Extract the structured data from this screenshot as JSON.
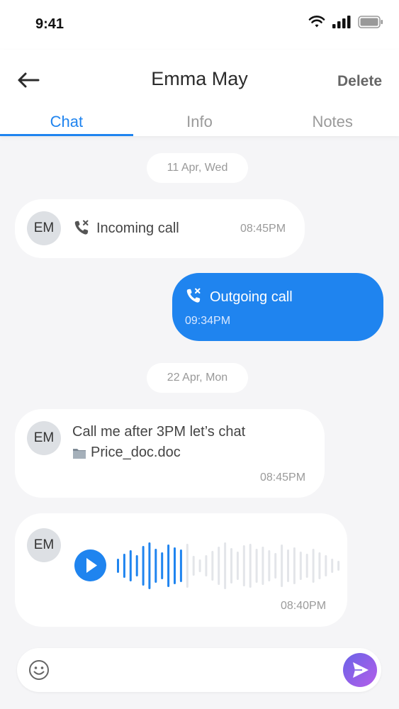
{
  "status": {
    "time": "9:41"
  },
  "header": {
    "title": "Emma May",
    "delete_label": "Delete"
  },
  "tabs": [
    {
      "label": "Chat",
      "active": true
    },
    {
      "label": "Info",
      "active": false
    },
    {
      "label": "Notes",
      "active": false
    }
  ],
  "messages": {
    "date1": "11 Apr, Wed",
    "incoming_call": {
      "avatar": "EM",
      "label": "Incoming call",
      "time": "08:45PM"
    },
    "outgoing_call": {
      "label": "Outgoing call",
      "time": "09:34PM"
    },
    "date2": "22 Apr, Mon",
    "text_msg": {
      "avatar": "EM",
      "text": "Call me after 3PM let’s chat",
      "attachment": "Price_doc.doc",
      "time": "08:45PM"
    },
    "voice_msg": {
      "avatar": "EM",
      "time": "08:40PM",
      "played_fraction": 0.3
    }
  },
  "composer": {
    "placeholder": ""
  },
  "colors": {
    "accent": "#1f84ef",
    "send_start": "#6a63e8",
    "send_end": "#b45ee9"
  },
  "icons": [
    "wifi-icon",
    "signal-icon",
    "battery-icon",
    "back-arrow-icon",
    "missed-call-icon",
    "file-icon",
    "play-icon",
    "emoji-icon",
    "send-icon"
  ]
}
